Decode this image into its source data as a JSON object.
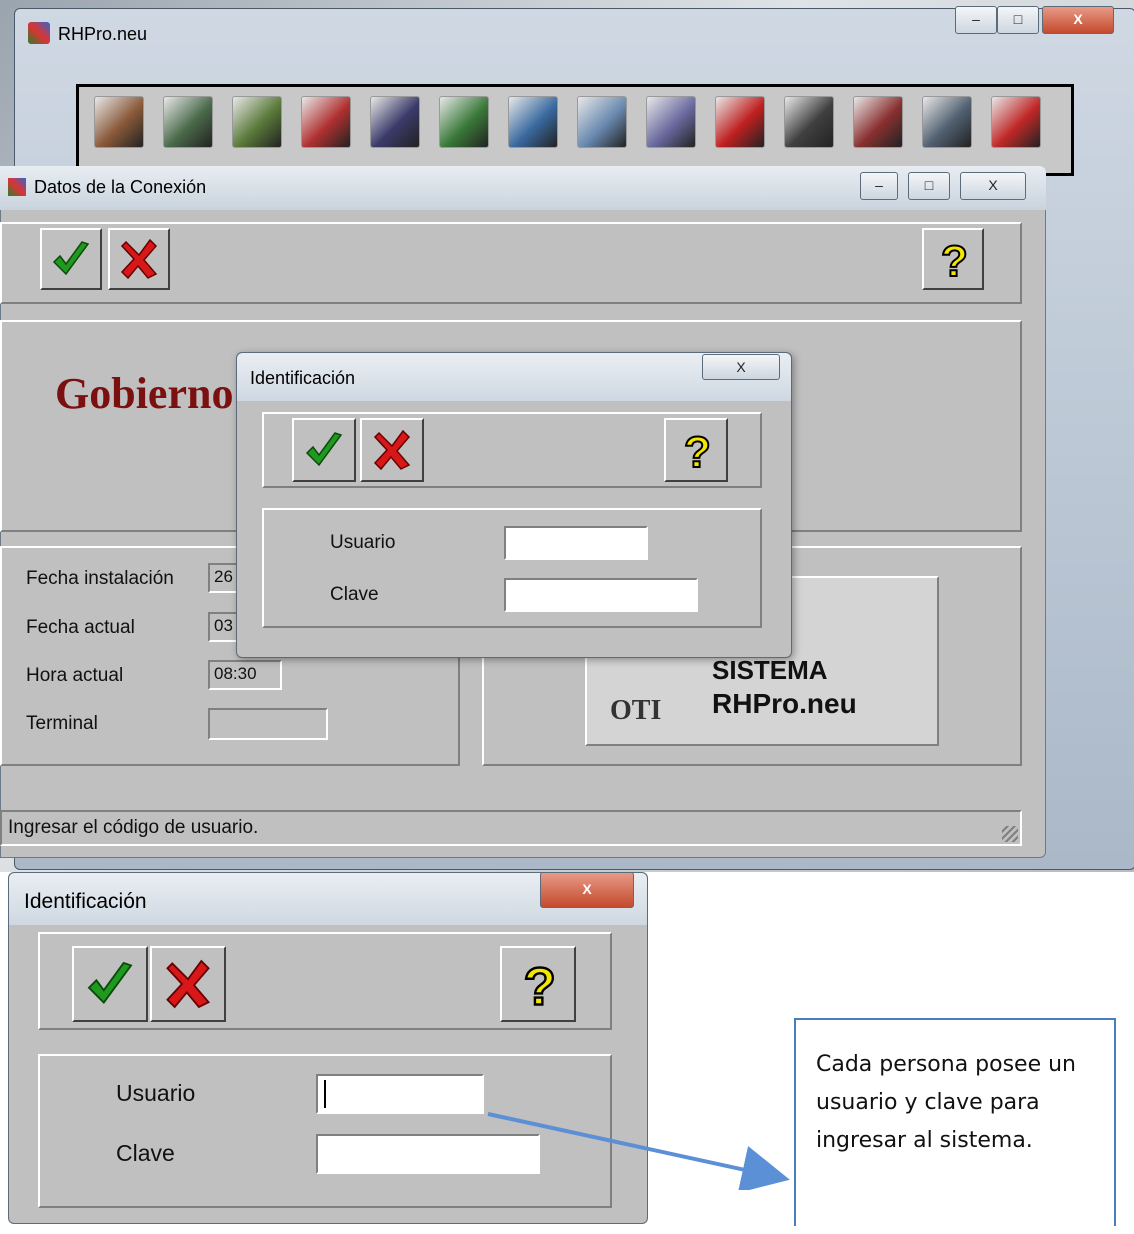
{
  "main_window": {
    "title": "RHPro.neu",
    "minimize": "–",
    "maximize": "□",
    "close": "X"
  },
  "toolbar": {
    "icons": [
      "exit-door-icon",
      "filing-cabinet-icon",
      "soldier-icon",
      "medical-kit-icon",
      "teacher-icon",
      "money-bag-icon",
      "runner-icon",
      "ambulance-icon",
      "certificate-icon",
      "chart-arrows-icon",
      "cellphone-icon",
      "calendar-icon",
      "computer-transfer-icon",
      "superman-shield-icon"
    ]
  },
  "conexion_window": {
    "title": "Datos de la Conexión",
    "banner": "Gobierno de la Provincia del Neuquén",
    "fields": {
      "fecha_instalacion_label": "Fecha instalación",
      "fecha_instalacion_value": "26",
      "fecha_actual_label": "Fecha actual",
      "fecha_actual_value": "03",
      "hora_actual_label": "Hora actual",
      "hora_actual_value": "08:30",
      "terminal_label": "Terminal",
      "terminal_value": ""
    },
    "logo": {
      "line1": "SISTEMA",
      "line2": "RHPro.neu",
      "org": "OTI"
    },
    "status": "Ingresar el código de usuario."
  },
  "identificacion_dialog": {
    "title": "Identificación",
    "usuario_label": "Usuario",
    "clave_label": "Clave",
    "usuario_value": "",
    "clave_value": "",
    "close": "X"
  },
  "identificacion_dialog_zoom": {
    "title": "Identificación",
    "usuario_label": "Usuario",
    "clave_label": "Clave",
    "usuario_value": "",
    "clave_value": "",
    "close": "X"
  },
  "callout": {
    "text": "Cada persona posee un usuario y clave para ingresar al sistema."
  },
  "colors": {
    "banner": "#7a1010",
    "panel": "#c0c0c0",
    "callout_border": "#4a7ebb",
    "arrow": "#5b8fd6"
  }
}
